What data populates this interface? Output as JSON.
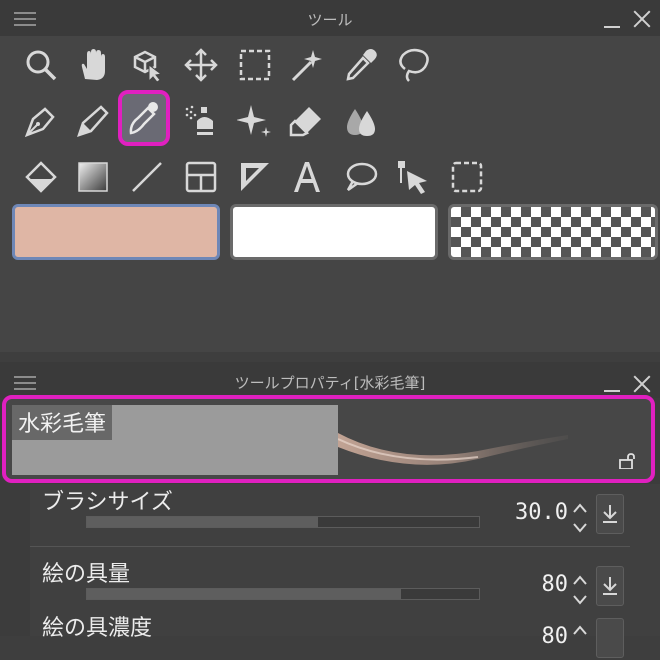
{
  "tool_panel": {
    "title": "ツール",
    "selected_tool": "watercolor-brush",
    "rows": [
      [
        "zoom",
        "move-view",
        "object",
        "move-layer",
        "rect-select",
        "auto-select",
        "eyedropper",
        "lasso"
      ],
      [
        "pen",
        "pencil",
        "brush",
        "airbrush",
        "decoration",
        "eraser",
        "blend"
      ],
      [
        "fill",
        "gradation",
        "figure",
        "frame-border",
        "ruler",
        "text",
        "balloon",
        "correct-line",
        "custom-tool"
      ]
    ],
    "colors": {
      "main": "#dfb6a5",
      "sub": "#ffffff",
      "transparent": "checker",
      "accent_highlight": "#e020c0"
    }
  },
  "property_panel": {
    "title": "ツールプロパティ[水彩毛筆]",
    "preset_name": "水彩毛筆",
    "properties": [
      {
        "label": "ブラシサイズ",
        "value": "30.0",
        "slider_fraction": 0.59
      },
      {
        "label": "絵の具量",
        "value": "80",
        "slider_fraction": 0.8
      },
      {
        "label": "絵の具濃度",
        "value": "80"
      }
    ]
  }
}
